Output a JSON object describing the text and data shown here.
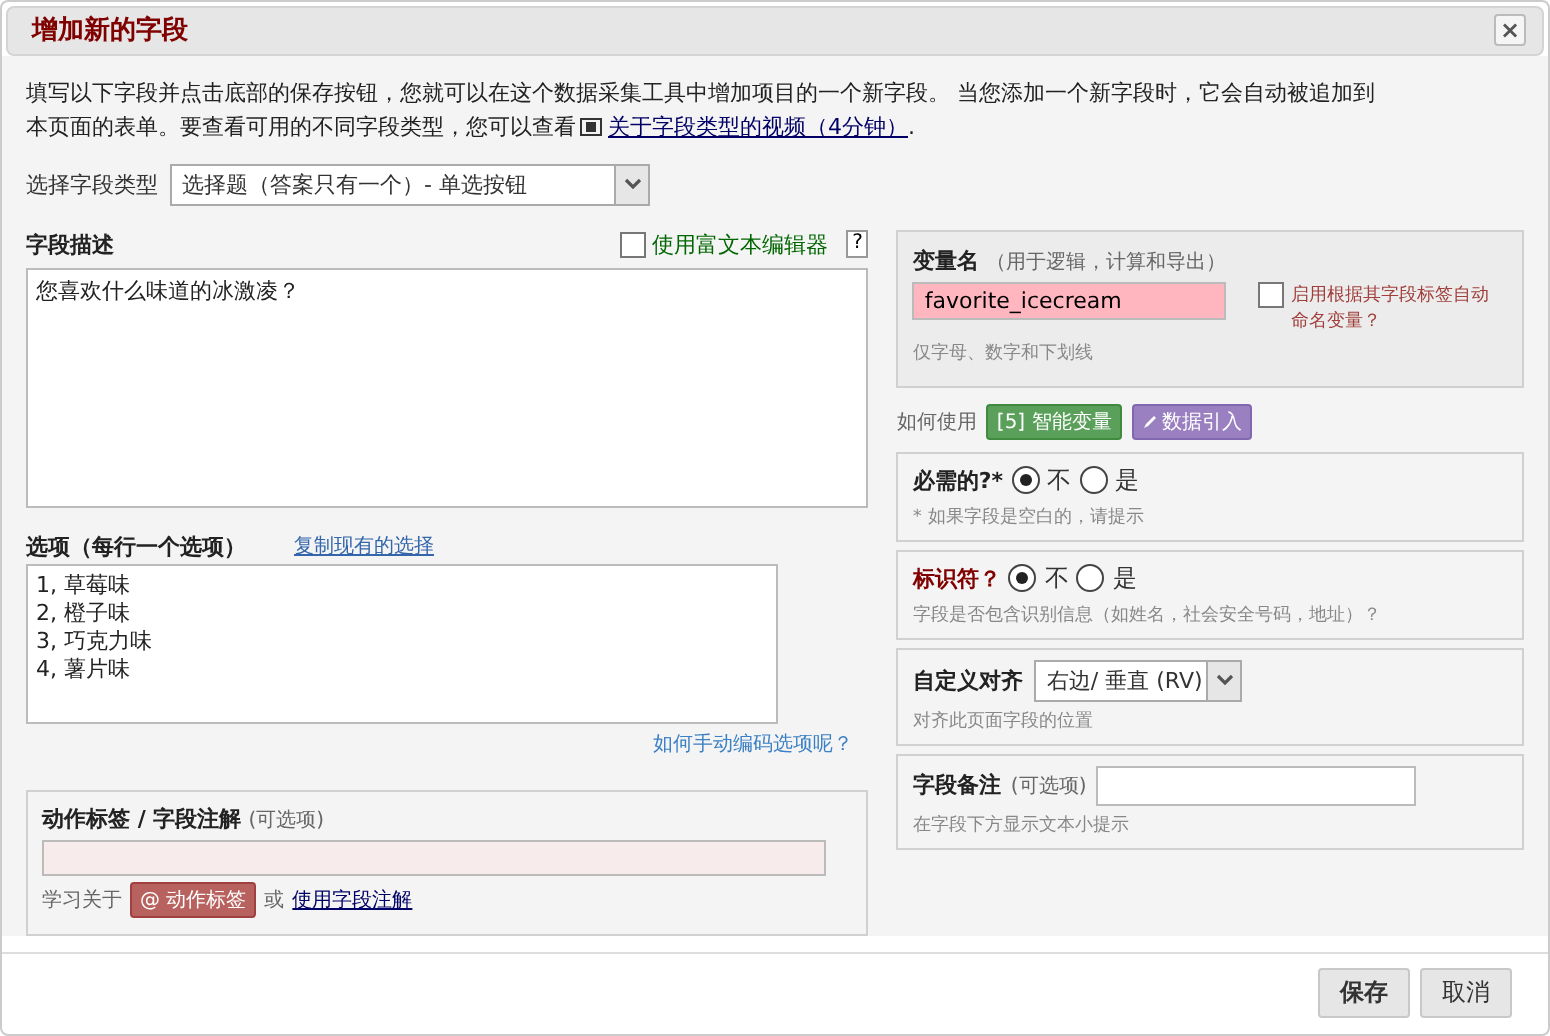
{
  "dialog": {
    "title": "增加新的字段",
    "close": "×"
  },
  "intro": {
    "line_1": "填写以下字段并点击底部的保存按钮，您就可以在这个数据采集工具中增加项目的一个新字段。 当您添加一个新字段时，它会自动被追加到",
    "line_2": "本页面的表单。要查看可用的不同字段类型，您可以查看",
    "link": "关于字段类型的视频（4分钟）",
    "end": "."
  },
  "field_type": {
    "label": "选择字段类型",
    "value": "选择题（答案只有一个）- 单选按钮"
  },
  "description": {
    "label": "字段描述",
    "rich_text": {
      "label": "使用富文本编辑器",
      "checked": false
    },
    "help": "?",
    "value": "您喜欢什么味道的冰激凌？"
  },
  "choices": {
    "label": "选项（每行一个选项）",
    "copy_link": "复制现有的选择",
    "lines": [
      "1, 草莓味",
      "2, 橙子味",
      "3, 巧克力味",
      "4, 薯片味"
    ],
    "manual_link": "如何手动编码选项呢？"
  },
  "action_tags": {
    "label": "动作标签 / 字段注解",
    "optional": "(可选项)",
    "learn": "学习关于",
    "tag_button": "@ 动作标签",
    "or": "或",
    "annotation_link": "使用字段注解"
  },
  "variable": {
    "label": "变量名",
    "note": "（用于逻辑，计算和导出）",
    "value": "favorite_icecream",
    "hint": "仅字母、数字和下划线",
    "auto": {
      "label": "启用根据其字段标签自动命名变量？",
      "checked": false
    }
  },
  "how_to": {
    "label": "如何使用",
    "smart": "[5] 智能变量",
    "piping": "数据引入"
  },
  "required": {
    "label": "必需的?*",
    "options": [
      {
        "label": "不",
        "selected": true
      },
      {
        "label": "是",
        "selected": false
      }
    ],
    "hint": "* 如果字段是空白的，请提示"
  },
  "identifier": {
    "label": "标识符？",
    "options": [
      {
        "label": "不",
        "selected": true
      },
      {
        "label": "是",
        "selected": false
      }
    ],
    "hint": "字段是否包含识别信息（如姓名，社会安全号码，地址）？"
  },
  "alignment": {
    "label": "自定义对齐",
    "value": "右边/ 垂直 (RV)",
    "hint": "对齐此页面字段的位置"
  },
  "field_note": {
    "label": "字段备注",
    "optional": "(可选项)",
    "hint": "在字段下方显示文本小提示"
  },
  "buttons": [
    {
      "label": "保存",
      "kind": "primary"
    },
    {
      "label": "取消",
      "kind": "secondary"
    }
  ]
}
